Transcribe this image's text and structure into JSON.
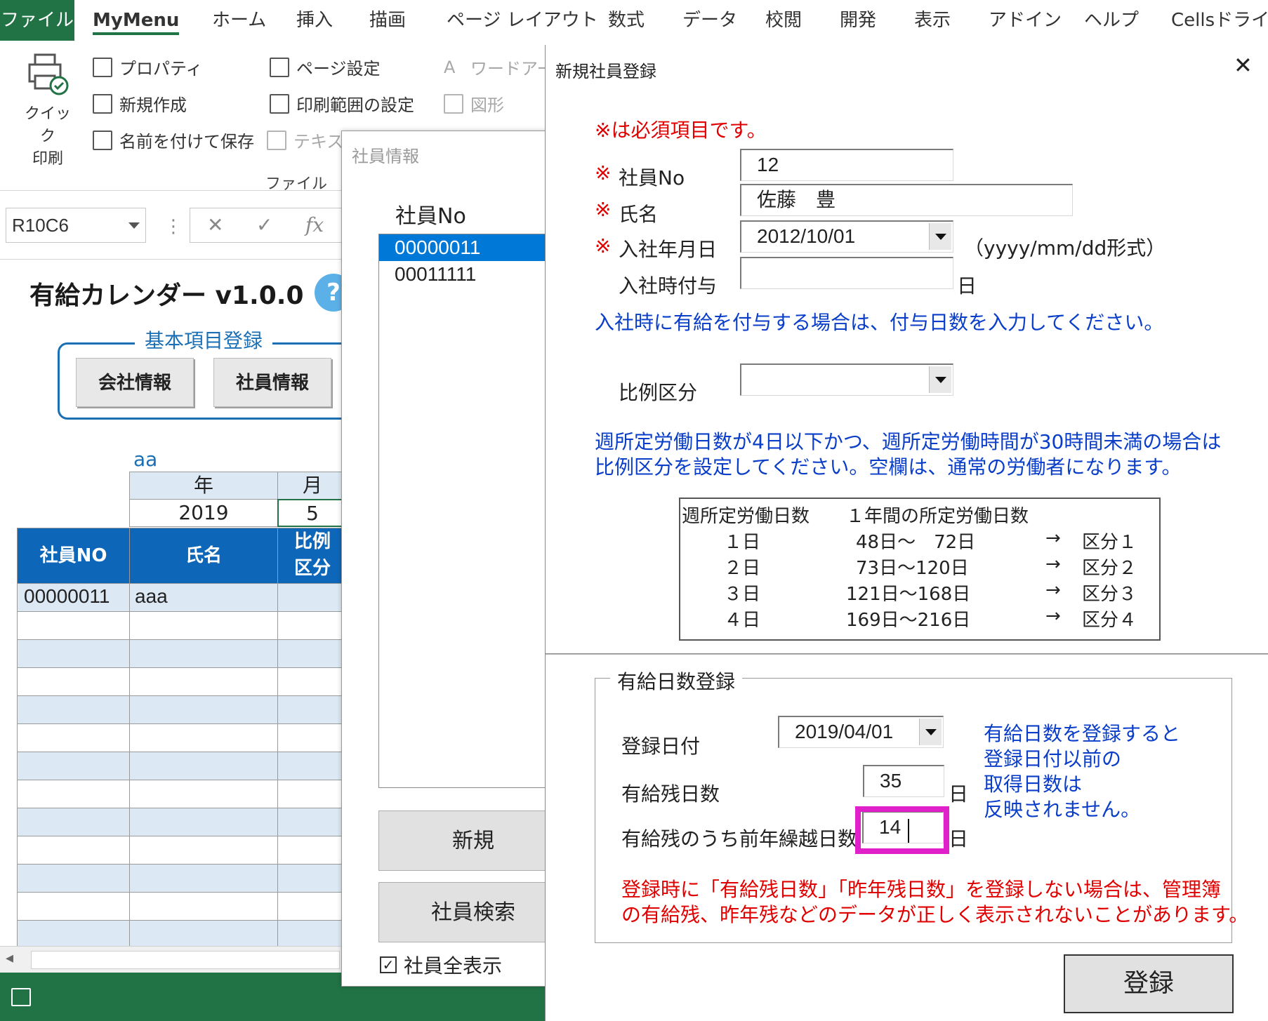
{
  "ribbon": {
    "tabs": [
      "ファイル",
      "MyMenu",
      "ホーム",
      "挿入",
      "描画",
      "ページ レイアウト",
      "数式",
      "データ",
      "校閲",
      "開発",
      "表示",
      "アドイン",
      "ヘルプ",
      "Cellsドライブ"
    ],
    "quick_print": [
      "クイック",
      "印刷"
    ],
    "items": {
      "properties": "プロパティ",
      "new": "新規作成",
      "save_as": "名前を付けて保存",
      "page_setup": "ページ設定",
      "print_area": "印刷範囲の設定",
      "textbox": "テキスト",
      "wordart": "ワードアート",
      "shapes": "図形"
    },
    "group_label": "ファイル"
  },
  "formula_bar": {
    "namebox": "R10C6",
    "cancel": "✕",
    "enter": "✓",
    "fx": "fx"
  },
  "sheet": {
    "title": "有給カレンダー v1.0.0",
    "help": "?",
    "group_label": "基本項目登録",
    "company_button": "会社情報",
    "employee_button": "社員情報",
    "note": "aa",
    "year_header": "年",
    "month_header": "月",
    "year_value": "2019",
    "month_value": "5",
    "col_no": "社員NO",
    "col_name": "氏名",
    "col_ratio_1": "比例",
    "col_ratio_2": "区分",
    "row1_no": "00000011",
    "row1_name": "aaa"
  },
  "employee_dialog": {
    "title": "社員情報",
    "list_label": "社員No",
    "items": [
      "00000011",
      "00011111"
    ],
    "new_button": "新規",
    "search_button": "社員検索",
    "show_all_label": "社員全表示",
    "show_all_checked": true
  },
  "main_dialog": {
    "title": "新規社員登録",
    "close": "✕",
    "required_note": "※は必須項目です。",
    "mark": "※",
    "emp_no_label": "社員No",
    "emp_no_value": "12",
    "name_label": "氏名",
    "name_value": "佐藤　豊",
    "join_date_label": "入社年月日",
    "join_date_value": "2012/10/01",
    "date_format_hint": "（yyyy/mm/dd形式）",
    "join_grant_label": "入社時付与",
    "day_unit": "日",
    "join_grant_note": "入社時に有給を付与する場合は、付与日数を入力してください。",
    "ratio_label": "比例区分",
    "ratio_note_1": "週所定労働日数が4日以下かつ、週所定労働時間が30時間未満の場合は",
    "ratio_note_2": "比例区分を設定してください。空欄は、通常の労働者になります。",
    "table": {
      "header_1": "週所定労働日数",
      "header_2": "１年間の所定労働日数",
      "rows": [
        {
          "days": "１日",
          "range": "48日～　72日",
          "arrow": "→",
          "cls": "区分１"
        },
        {
          "days": "２日",
          "range": "73日～120日",
          "arrow": "→",
          "cls": "区分２"
        },
        {
          "days": "３日",
          "range": "121日～168日",
          "arrow": "→",
          "cls": "区分３"
        },
        {
          "days": "４日",
          "range": "169日～216日",
          "arrow": "→",
          "cls": "区分４"
        }
      ]
    },
    "paid_group_label": "有給日数登録",
    "reg_date_label": "登録日付",
    "reg_date_value": "2019/04/01",
    "remaining_label": "有給残日数",
    "remaining_value": "35",
    "carryover_label": "有給残のうち前年繰越日数",
    "carryover_value": "14",
    "side_note": [
      "有給日数を登録すると",
      "登録日付以前の",
      "取得日数は",
      "反映されません。"
    ],
    "warning_1": "登録時に「有給残日数」「昨年残日数」を登録しない場合は、管理簿",
    "warning_2": "の有給残、昨年残などのデータが正しく表示されないことがあります。",
    "register_button": "登録"
  },
  "colors": {
    "excel_green": "#217346",
    "header_blue": "#0d66b8",
    "light_blue": "#dce9f5",
    "red_text": "#e00000",
    "blue_text": "#0a3ec9",
    "highlight": "#e020c8"
  }
}
